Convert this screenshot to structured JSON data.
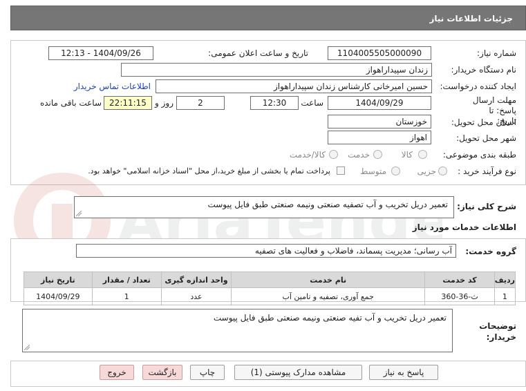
{
  "header": {
    "title": "جزئیات اطلاعات نیاز"
  },
  "form": {
    "need_number": {
      "label": "شماره نیاز:",
      "value": "1104005505000090"
    },
    "announce_datetime": {
      "label": "تاریخ و ساعت اعلان عمومی:",
      "value": "1404/09/26 - 12:13"
    },
    "buyer_org": {
      "label": "نام دستگاه خریدار:",
      "value": "زندان سپیداراهواز"
    },
    "requester": {
      "label": "ایجاد کننده درخواست:",
      "value": "حسین امیرخانی کارشناس زندان سپیداراهواز",
      "link": "اطلاعات تماس خریدار"
    },
    "deadline": {
      "label": "مهلت ارسال پاسخ: تا تاریخ:",
      "date": "1404/09/29",
      "time_label": "ساعت",
      "time": "12:30",
      "days": "2",
      "days_label": "روز و",
      "remaining": "22:11:15",
      "remaining_label": "ساعت باقی مانده"
    },
    "province": {
      "label": "استان محل تحویل:",
      "value": "خوزستان"
    },
    "city": {
      "label": "شهر محل تحویل:",
      "value": "اهواز"
    },
    "category": {
      "label": "طبقه بندی موضوعی:",
      "options": [
        "کالا",
        "خدمت",
        "کالا/خدمت"
      ],
      "selected": ""
    },
    "process": {
      "label": "نوع فرآیند خرید :",
      "options": [
        "جزیی",
        "متوسط"
      ],
      "payment_note": "پرداخت تمام یا بخشی از مبلغ خرید،از محل \"اسناد خزانه اسلامی\" خواهد بود."
    }
  },
  "summary": {
    "label": "شرح کلی نیاز:",
    "value": "تعمیر دریل تخریب و آب تصفیه صنعتی ونیمه صنعتی طبق فایل پیوست"
  },
  "services": {
    "section_title": "اطلاعات خدمات مورد نیاز",
    "group_label": "گروه خدمت:",
    "group_value": "آب رسانی؛ مدیریت پسماند، فاضلاب و فعالیت های تصفیه",
    "columns": [
      "ردیف",
      "کد خدمت",
      "نام خدمت",
      "واحد اندازه گیری",
      "تعداد / مقدار",
      "تاریخ نیاز"
    ],
    "rows": [
      {
        "row": "1",
        "code": "ث-36-360",
        "name": "جمع آوری، تصفیه و تامین آب",
        "unit": "عدد",
        "qty": "1",
        "date": "1404/09/29"
      }
    ]
  },
  "buyer_notes": {
    "label": "توضیحات خریدار:",
    "value": "تعمیر دریل تخریب و آب تفیه صنعتی ونیمه صنعتی طبق فایل پیوست"
  },
  "buttons": {
    "reply": "پاسخ به نیاز",
    "attachments": "مشاهده مدارک پیوستی (1)",
    "print": "چاپ",
    "back": "بازگشت",
    "exit": "خروج"
  },
  "watermark": {
    "text": "AriaTender.net"
  },
  "colors": {
    "header_bg": "#767676",
    "highlight": "#ffffc8",
    "pink_button": "#f7d9d9",
    "link": "#1f3fb5"
  }
}
